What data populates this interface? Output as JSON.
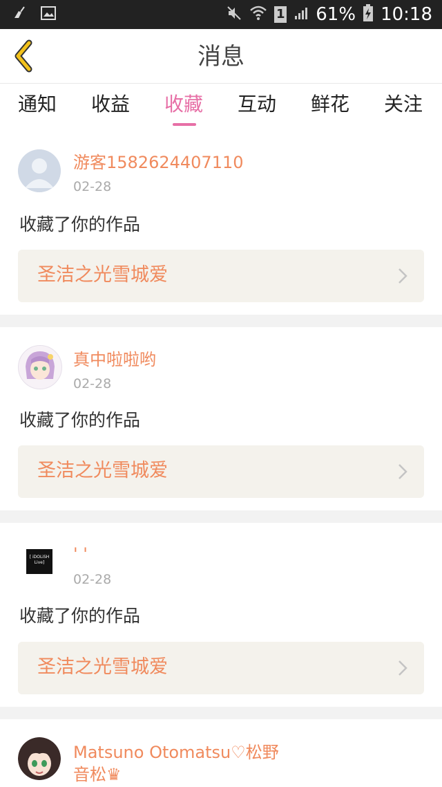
{
  "status_bar": {
    "battery_percent": "61%",
    "time": "10:18",
    "sim_badge": "1",
    "icons": [
      "cleaner-icon",
      "image-icon",
      "mute-icon",
      "wifi-icon",
      "signal-icon",
      "battery-charging-icon"
    ]
  },
  "header": {
    "title": "消息",
    "back_icon": "chevron-left-icon"
  },
  "tabs": [
    {
      "label": "通知",
      "active": false
    },
    {
      "label": "收益",
      "active": false
    },
    {
      "label": "收藏",
      "active": true
    },
    {
      "label": "互动",
      "active": false
    },
    {
      "label": "鲜花",
      "active": false
    },
    {
      "label": "关注",
      "active": false
    }
  ],
  "messages": [
    {
      "username": "游客1582624407110",
      "date": "02-28",
      "action": "收藏了你的作品",
      "work_title": "圣洁之光雪城爱",
      "avatar": "default-user-avatar"
    },
    {
      "username": "真中啦啦哟",
      "date": "02-28",
      "action": "收藏了你的作品",
      "work_title": "圣洁之光雪城爱",
      "avatar": "anime-girl-avatar"
    },
    {
      "username": "' '",
      "date": "02-28",
      "action": "收藏了你的作品",
      "work_title": "圣洁之光雪城爱",
      "avatar": "idol-live-avatar",
      "avatar_text": "[ iDOLiSH Live]"
    },
    {
      "username": "Matsuno Otomatsu♡松野音松♛",
      "date": "",
      "action": "",
      "work_title": "",
      "avatar": "anime-boy-avatar"
    }
  ],
  "colors": {
    "accent_pink": "#e76fa6",
    "accent_orange": "#f08a5d",
    "back_yellow": "#f3c21b",
    "card_bg": "#f4f2ec",
    "divider": "#f2f2f2"
  }
}
